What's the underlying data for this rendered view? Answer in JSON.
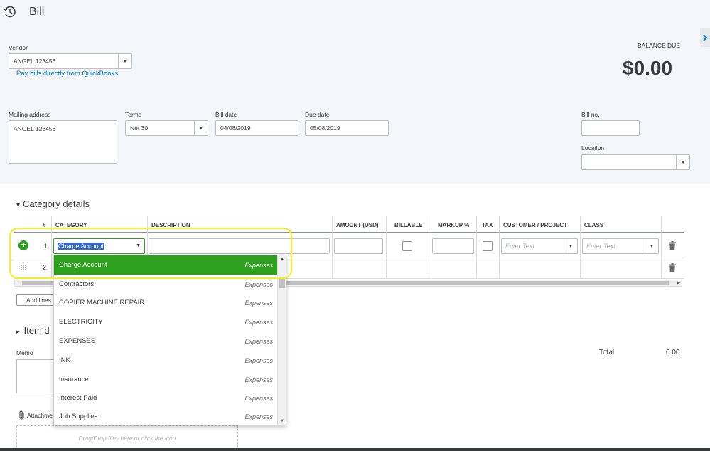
{
  "header": {
    "title": "Bill"
  },
  "vendor": {
    "label": "Vendor",
    "value": "ANGEL 123456",
    "pay_link": "Pay bills directly from QuickBooks"
  },
  "balance": {
    "label": "BALANCE DUE",
    "amount": "$0.00"
  },
  "mailing": {
    "label": "Mailing address",
    "value": "ANGEL 123456"
  },
  "terms": {
    "label": "Terms",
    "value": "Net 30"
  },
  "bill_date": {
    "label": "Bill date",
    "value": "04/08/2019"
  },
  "due_date": {
    "label": "Due date",
    "value": "05/08/2019"
  },
  "bill_no": {
    "label": "Bill no.",
    "value": ""
  },
  "location": {
    "label": "Location",
    "value": ""
  },
  "category_section": {
    "title": "Category details",
    "toggle": "▾"
  },
  "item_section": {
    "title": "Item d",
    "toggle": "▸"
  },
  "table": {
    "headers": [
      "#",
      "CATEGORY",
      "DESCRIPTION",
      "AMOUNT (USD)",
      "BILLABLE",
      "MARKUP %",
      "TAX",
      "CUSTOMER / PROJECT",
      "CLASS"
    ],
    "rows": [
      {
        "num": "1",
        "category": "Charge Account"
      },
      {
        "num": "2"
      }
    ],
    "customer_placeholder": "Enter Text",
    "class_placeholder": "Enter Text"
  },
  "add_lines": "Add lines",
  "memo": {
    "label": "Memo"
  },
  "attachments": {
    "label": "Attachme",
    "drop_hint": "Drag/Drop files here or click the icon"
  },
  "total": {
    "label": "Total",
    "value": "0.00"
  },
  "category_menu": [
    {
      "name": "Charge Account",
      "type": "Expenses",
      "selected": true
    },
    {
      "name": "Contractors",
      "type": "Expenses"
    },
    {
      "name": "COPIER MACHINE REPAIR",
      "type": "Expenses"
    },
    {
      "name": "ELECTRICITY",
      "type": "Expenses"
    },
    {
      "name": "EXPENSES",
      "type": "Expenses"
    },
    {
      "name": "INK",
      "type": "Expenses"
    },
    {
      "name": "Insurance",
      "type": "Expenses"
    },
    {
      "name": "Interest Paid",
      "type": "Expenses"
    },
    {
      "name": "Job Supplies",
      "type": "Expenses"
    }
  ],
  "colors": {
    "accent_green": "#2ca01c",
    "highlight_yellow": "#f2f218",
    "link_blue": "#0077c5",
    "selection_blue": "#3367d6"
  },
  "icons": [
    "history-icon",
    "collapse-panel-icon",
    "add-line-icon",
    "drag-handle-icon",
    "trash-icon",
    "paperclip-icon"
  ]
}
